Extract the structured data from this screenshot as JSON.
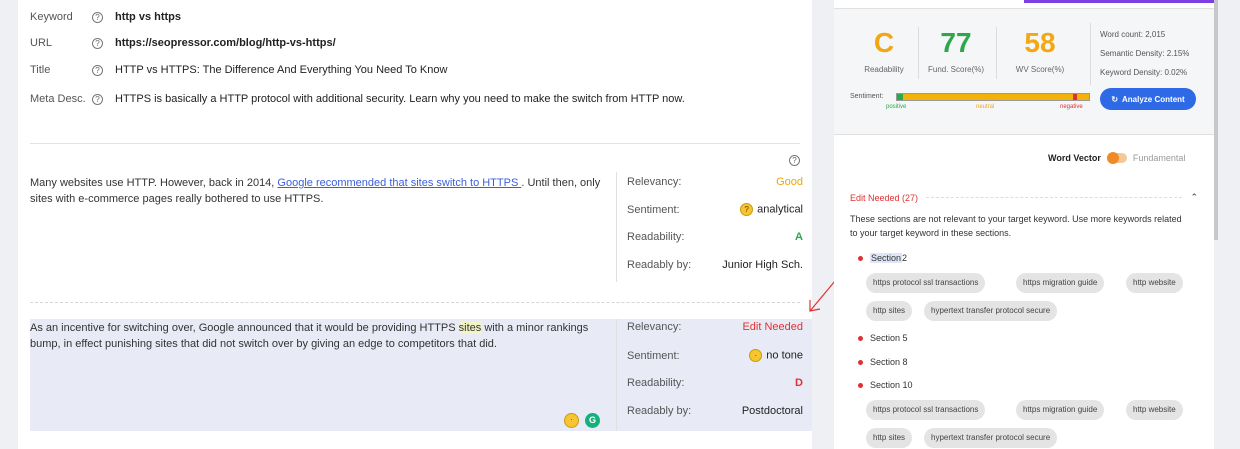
{
  "meta": {
    "keyword_label": "Keyword",
    "keyword": "http vs https",
    "url_label": "URL",
    "url": "https://seopressor.com/blog/http-vs-https/",
    "title_label": "Title",
    "title": "HTTP vs HTTPS: The Difference And Everything You Need To Know",
    "meta_label": "Meta Desc.",
    "meta_desc": "HTTPS is basically a HTTP protocol with additional security. Learn why you need to make the switch from HTTP now.",
    "help_glyph": "?"
  },
  "sections": [
    {
      "text_before": "Many websites use HTTP. However, back in 2014, ",
      "link": "Google recommended that sites switch to HTTPS ",
      "text_after": ". Until then, only sites with e-commerce pages really bothered to use HTTPS.",
      "relevancy_label": "Relevancy:",
      "relevancy": "Good",
      "sentiment_label": "Sentiment:",
      "sentiment": "analytical",
      "readability_label": "Readability:",
      "readability": "A",
      "readably_label": "Readably by:",
      "readably": "Junior High Sch."
    },
    {
      "text_before": "As an incentive for switching over, Google announced that it would be providing HTTPS ",
      "highlight": "sites",
      "text_after": " with a minor rankings bump, in effect punishing sites that did not switch over by giving an edge to competitors that did.",
      "relevancy_label": "Relevancy:",
      "relevancy": "Edit Needed",
      "sentiment_label": "Sentiment:",
      "sentiment": "no tone",
      "readability_label": "Readability:",
      "readability": "D",
      "readably_label": "Readably by:",
      "readably": "Postdoctoral",
      "grammarly_glyph": "G"
    }
  ],
  "scores": {
    "readability_grade": "C",
    "readability_label": "Readability",
    "fund_score": "77",
    "fund_label": "Fund. Score(%)",
    "wv_score": "58",
    "wv_label": "WV Score(%)",
    "word_count": "Word count: 2,015",
    "semantic_density": "Semantic Density: 2.15%",
    "keyword_density": "Keyword Density: 0.02%",
    "analyze_button": "Analyze Content",
    "sentiment_label": "Sentiment:",
    "positive": "positive",
    "neutral": "neutral",
    "negative": "negative",
    "grade_color": "#f3a712",
    "fund_color": "#2aa84a",
    "wv_color": "#f3a712"
  },
  "word_vector": {
    "label": "Word Vector",
    "alt": "Fundamental"
  },
  "edit_needed": {
    "header": "Edit Needed (27)",
    "description": "These sections are not relevant to your target keyword. Use more keywords related to your target keyword in these sections.",
    "section_2_word": "Section",
    "section_2_num": " 2",
    "section_5": "Section 5",
    "section_8": "Section 8",
    "section_10": "Section 10",
    "chips_a": [
      "https protocol ssl transactions",
      "https migration guide",
      "http website",
      "http sites",
      "hypertext transfer protocol secure"
    ],
    "chips_b": [
      "https protocol ssl transactions",
      "https migration guide",
      "http website",
      "http sites",
      "hypertext transfer protocol secure"
    ]
  }
}
